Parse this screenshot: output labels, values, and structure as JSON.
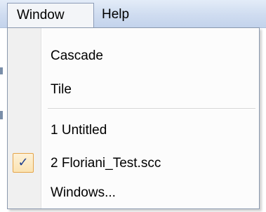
{
  "menubar": {
    "menus": [
      {
        "label": "Window",
        "open": true
      },
      {
        "label": "Help",
        "open": false
      }
    ]
  },
  "window_menu": {
    "items": [
      {
        "label": "Cascade",
        "checked": false
      },
      {
        "label": "Tile",
        "checked": false
      },
      {
        "label": "1 Untitled",
        "checked": false
      },
      {
        "label": "2 Floriani_Test.scc",
        "checked": true
      },
      {
        "label": "Windows...",
        "checked": false
      }
    ],
    "check_glyph": "✓"
  },
  "colors": {
    "menubar_bg": "#cfdcf0",
    "menu_bg": "#fcfcfc",
    "gutter_bg": "#f0f0f0",
    "check_highlight": "#fbe3b2",
    "check_border": "#e5a54a",
    "check_mark": "#1e3f8f"
  }
}
